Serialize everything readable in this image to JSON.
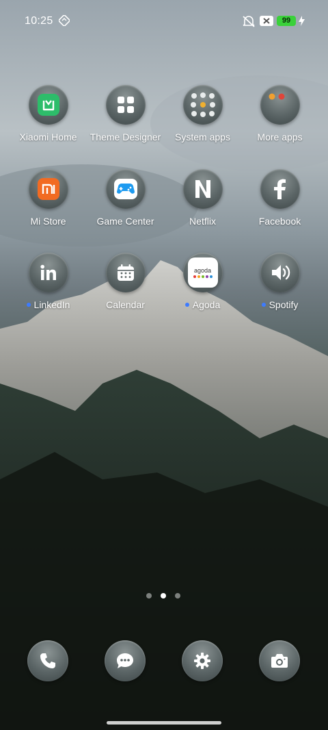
{
  "status_bar": {
    "time": "10:25",
    "battery_level": "99",
    "icons": [
      "nfc-icon",
      "mute-icon",
      "no-sim-icon",
      "battery-icon",
      "charging-icon"
    ]
  },
  "apps": [
    {
      "label": "Xiaomi Home",
      "icon": "xiaomi-home-icon",
      "new": false
    },
    {
      "label": "Theme Designer",
      "icon": "grid-icon",
      "new": false
    },
    {
      "label": "System apps",
      "icon": "folder-icon",
      "new": false
    },
    {
      "label": "More apps",
      "icon": "folder-icon",
      "new": false
    },
    {
      "label": "Mi Store",
      "icon": "mi-store-icon",
      "new": false
    },
    {
      "label": "Game Center",
      "icon": "gamepad-icon",
      "new": false
    },
    {
      "label": "Netflix",
      "icon": "netflix-icon",
      "new": false
    },
    {
      "label": "Facebook",
      "icon": "facebook-icon",
      "new": false
    },
    {
      "label": "LinkedIn",
      "icon": "linkedin-icon",
      "new": true
    },
    {
      "label": "Calendar",
      "icon": "calendar-icon",
      "new": false
    },
    {
      "label": "Agoda",
      "icon": "agoda-icon",
      "new": true,
      "icon_text": "agoda"
    },
    {
      "label": "Spotify",
      "icon": "speaker-icon",
      "new": true
    }
  ],
  "pager": {
    "pages": 3,
    "current": 2
  },
  "dock": [
    {
      "icon": "phone-icon"
    },
    {
      "icon": "messages-icon"
    },
    {
      "icon": "settings-icon"
    },
    {
      "icon": "camera-icon"
    }
  ]
}
